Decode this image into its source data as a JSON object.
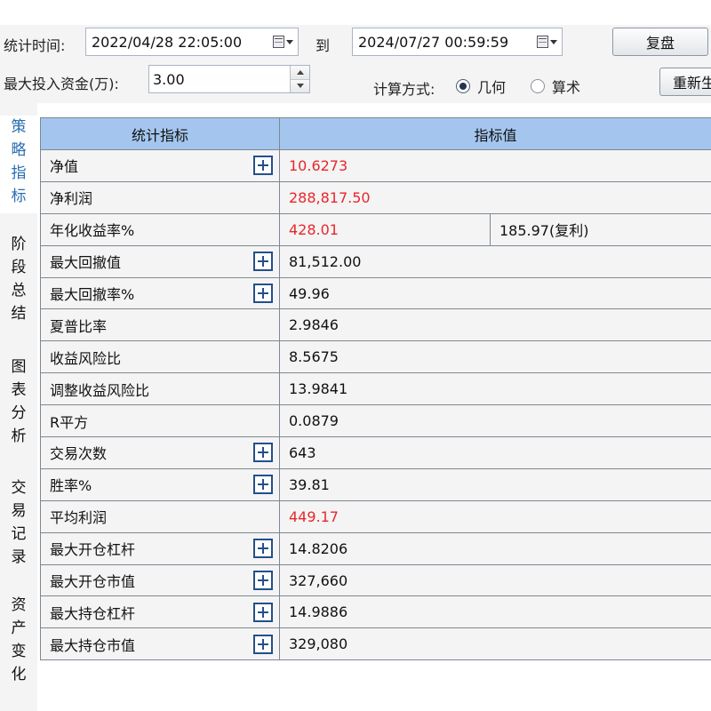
{
  "controls": {
    "stat_time_label": "统计时间:",
    "start_datetime": "2022/04/28 22:05:00",
    "to_label": "到",
    "end_datetime": "2024/07/27 00:59:59",
    "replay_button": "复盘",
    "max_capital_label": "最大投入资金(万):",
    "max_capital_value": "3.00",
    "calc_method_label": "计算方式:",
    "calc_options": [
      {
        "label": "几何",
        "selected": true
      },
      {
        "label": "算术",
        "selected": false
      }
    ],
    "recalc_button": "重新生成"
  },
  "side_tabs": [
    {
      "label": "策略指标",
      "active": true
    },
    {
      "label": "阶段总结",
      "active": false
    },
    {
      "label": "图表分析",
      "active": false
    },
    {
      "label": "交易记录",
      "active": false
    },
    {
      "label": "资产变化",
      "active": false
    }
  ],
  "table": {
    "headers": [
      "统计指标",
      "指标值"
    ],
    "rows": [
      {
        "name": "净值",
        "expandable": true,
        "value": "10.6273",
        "value_color": "red",
        "extra": ""
      },
      {
        "name": "净利润",
        "expandable": false,
        "value": "288,817.50",
        "value_color": "red",
        "extra": ""
      },
      {
        "name": "年化收益率%",
        "expandable": false,
        "value": "428.01",
        "value_color": "red",
        "extra": "185.97(复利)"
      },
      {
        "name": "最大回撤值",
        "expandable": true,
        "value": "81,512.00",
        "value_color": "black",
        "extra": ""
      },
      {
        "name": "最大回撤率%",
        "expandable": true,
        "value": "49.96",
        "value_color": "black",
        "extra": ""
      },
      {
        "name": "夏普比率",
        "expandable": false,
        "value": "2.9846",
        "value_color": "black",
        "extra": ""
      },
      {
        "name": "收益风险比",
        "expandable": false,
        "value": "8.5675",
        "value_color": "black",
        "extra": ""
      },
      {
        "name": "调整收益风险比",
        "expandable": false,
        "value": "13.9841",
        "value_color": "black",
        "extra": ""
      },
      {
        "name": "R平方",
        "expandable": false,
        "value": "0.0879",
        "value_color": "black",
        "extra": ""
      },
      {
        "name": "交易次数",
        "expandable": true,
        "value": "643",
        "value_color": "black",
        "extra": ""
      },
      {
        "name": "胜率%",
        "expandable": true,
        "value": "39.81",
        "value_color": "black",
        "extra": ""
      },
      {
        "name": "平均利润",
        "expandable": false,
        "value": "449.17",
        "value_color": "red",
        "extra": ""
      },
      {
        "name": "最大开仓杠杆",
        "expandable": true,
        "value": "14.8206",
        "value_color": "black",
        "extra": ""
      },
      {
        "name": "最大开仓市值",
        "expandable": true,
        "value": "327,660",
        "value_color": "black",
        "extra": ""
      },
      {
        "name": "最大持仓杠杆",
        "expandable": true,
        "value": "14.9886",
        "value_color": "black",
        "extra": ""
      },
      {
        "name": "最大持仓市值",
        "expandable": true,
        "value": "329,080",
        "value_color": "black",
        "extra": ""
      }
    ]
  },
  "colors": {
    "header_bg": "#a4c6ee",
    "positive_value": "#e8262c",
    "active_tab_text": "#2a6db0",
    "plus_icon": "#244f8a"
  }
}
